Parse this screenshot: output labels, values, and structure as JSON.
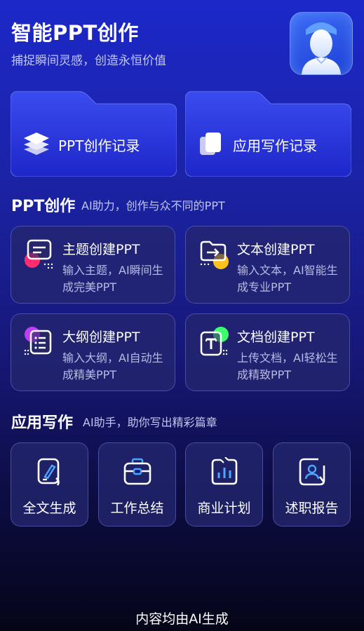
{
  "header": {
    "title": "智能PPT创作",
    "subtitle": "捕捉瞬间灵感，创造永恒价值"
  },
  "records": [
    {
      "label": "PPT创作记录",
      "icon": "layers-icon"
    },
    {
      "label": "应用写作记录",
      "icon": "documents-stack-icon"
    }
  ],
  "ppt_section": {
    "title": "PPT创作",
    "subtitle": "AI助力，创作与众不同的PPT",
    "cards": [
      {
        "title": "主题创建PPT",
        "desc": "输入主题，AI瞬间生成完美PPT",
        "icon": "chat-bubble-icon",
        "accent": "#ff2d6f"
      },
      {
        "title": "文本创建PPT",
        "desc": "输入文本，AI智能生成专业PPT",
        "icon": "folder-arrow-icon",
        "accent": "#ffc21a"
      },
      {
        "title": "大纲创建PPT",
        "desc": "输入大纲，AI自动生成精美PPT",
        "icon": "outline-list-icon",
        "accent": "#c13bff"
      },
      {
        "title": "文档创建PPT",
        "desc": "上传文档，AI轻松生成精致PPT",
        "icon": "text-document-icon",
        "accent": "#3dff6b"
      }
    ]
  },
  "writing_section": {
    "title": "应用写作",
    "subtitle": "AI助手，助你写出精彩篇章",
    "tiles": [
      {
        "label": "全文生成",
        "icon": "pen-document-icon"
      },
      {
        "label": "工作总结",
        "icon": "briefcase-icon"
      },
      {
        "label": "商业计划",
        "icon": "bar-chart-icon"
      },
      {
        "label": "述职报告",
        "icon": "user-report-icon"
      }
    ]
  },
  "footer": {
    "text": "内容均由AI生成"
  }
}
